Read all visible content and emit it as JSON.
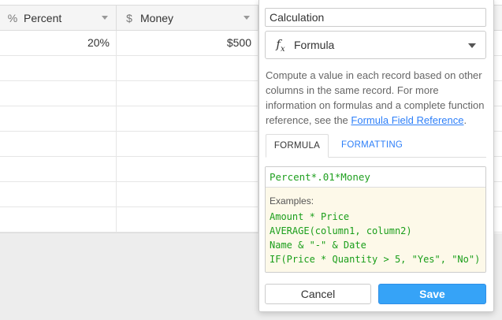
{
  "grid": {
    "columns": [
      {
        "name": "Percent",
        "icon": "percent-icon",
        "glyph": "%"
      },
      {
        "name": "Money",
        "icon": "dollar-icon",
        "glyph": "$"
      }
    ],
    "rows": [
      {
        "percent": "20%",
        "money": "$500"
      },
      {
        "percent": "",
        "money": ""
      },
      {
        "percent": "",
        "money": ""
      },
      {
        "percent": "",
        "money": ""
      },
      {
        "percent": "",
        "money": ""
      },
      {
        "percent": "",
        "money": ""
      },
      {
        "percent": "",
        "money": ""
      },
      {
        "percent": "",
        "money": ""
      }
    ]
  },
  "popup": {
    "field_name": "Calculation",
    "field_type": "Formula",
    "field_type_icon": "fx-icon",
    "description_before": "Compute a value in each record based on other columns in the same record. For more information on formulas and a complete function reference, see the ",
    "description_link": "Formula Field Reference",
    "description_after": ".",
    "tabs": {
      "formula": "FORMULA",
      "formatting": "FORMATTING"
    },
    "formula": "Percent*.01*Money",
    "examples_title": "Examples:",
    "examples": [
      "Amount * Price",
      "AVERAGE(column1, column2)",
      "Name & \"-\" & Date",
      "IF(Price * Quantity > 5, \"Yes\", \"No\")"
    ],
    "cancel_label": "Cancel",
    "save_label": "Save"
  },
  "colors": {
    "accent": "#2d7ff9",
    "save_button": "#36a3f7",
    "formula_text": "#20a020",
    "examples_bg": "#fdf9e9"
  }
}
